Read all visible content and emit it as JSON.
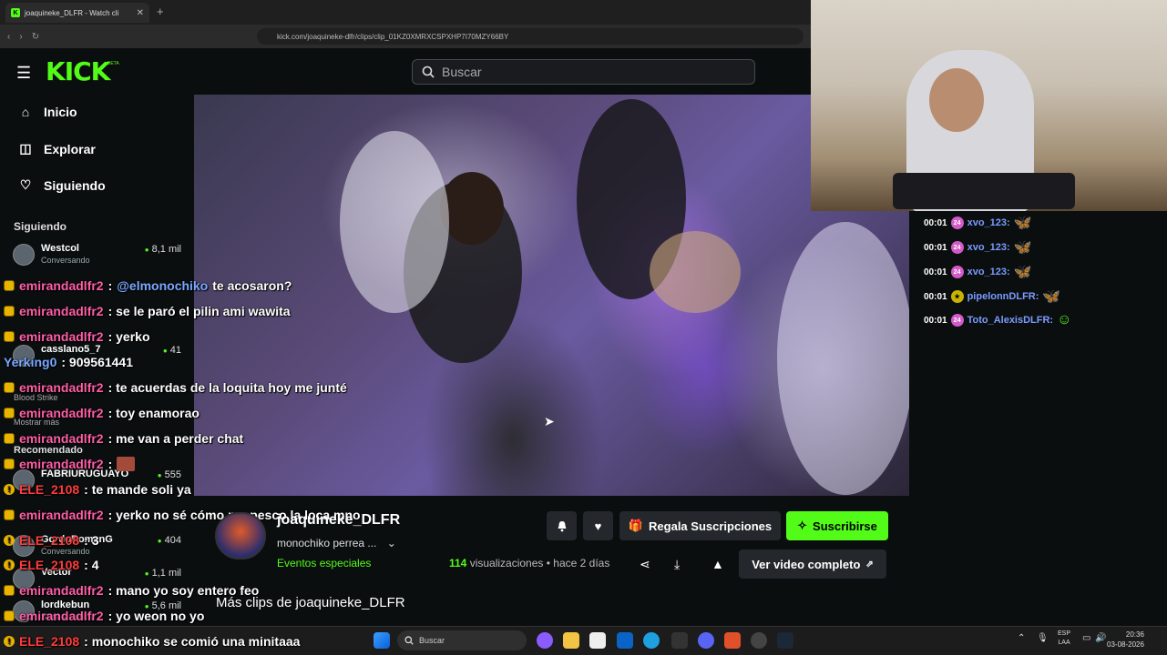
{
  "browser": {
    "tab_title": "joaquineke_DLFR - Watch cli",
    "url": "kick.com/joaquineke-dlfr/clips/clip_01KZ0XMRXCSPXHP7I70MZY66BY",
    "new_tab": "+",
    "close": "✕"
  },
  "header": {
    "logo": "KICK",
    "logo_beta": "BETA",
    "search_placeholder": "Buscar"
  },
  "sidebar": {
    "nav": [
      {
        "label": "Inicio",
        "icon": "home-icon"
      },
      {
        "label": "Explorar",
        "icon": "compass-icon"
      },
      {
        "label": "Siguiendo",
        "icon": "heart-icon"
      }
    ],
    "following_heading": "Siguiendo",
    "channels": [
      {
        "name": "Westcol",
        "category": "Conversando",
        "viewers": "8,1 mil"
      },
      {
        "name": "casslano5_7",
        "category": "",
        "viewers": "41"
      },
      {
        "name": "FABRIURUGUAYO",
        "category": "",
        "viewers": "555"
      },
      {
        "name": "GordoRomanG",
        "category": "Conversando",
        "viewers": "404"
      },
      {
        "name": "Vector",
        "category": "",
        "viewers": "1,1 mil"
      },
      {
        "name": "lordkebun",
        "category": "Slots & Casino",
        "viewers": "5,6 mil"
      }
    ],
    "show_more": "Mostrar más",
    "recommended_heading": "Recomendado",
    "blood_strike": "Blood Strike"
  },
  "overlay_chat": [
    {
      "user": "emirandadlfr2",
      "text": ": ",
      "mention": "@elmonochiko",
      "rest": " te acosaron?"
    },
    {
      "user": "emirandadlfr2",
      "text": ": se le paró el pilin ami wawita"
    },
    {
      "user": "emirandadlfr2",
      "text": ": yerko"
    },
    {
      "user": "Yerking0",
      "text": ": 909561441"
    },
    {
      "user": "emirandadlfr2",
      "text": ": te acuerdas de la loquita hoy me junté"
    },
    {
      "user": "emirandadlfr2",
      "text": ": toy enamorao"
    },
    {
      "user": "emirandadlfr2",
      "text": ": me van a perder chat"
    },
    {
      "user": "emirandadlfr2",
      "text": ":"
    },
    {
      "user": "ELE_2108",
      "text": ": te mande soli ya"
    },
    {
      "user": "emirandadlfr2",
      "text": ": yerko no sé cómo me pesco la loca mno"
    },
    {
      "user": "ELE_2108",
      "text": ": 3"
    },
    {
      "user": "ELE_2108",
      "text": ": 4"
    },
    {
      "user": "emirandadlfr2",
      "text": ": mano yo soy entero feo"
    },
    {
      "user": "emirandadlfr2",
      "text": ": yo weon no yo"
    },
    {
      "user": "ELE_2108",
      "text": ": monochiko se comió una minitaaa"
    }
  ],
  "right_chat": [
    {
      "time": "00:01",
      "badge": "24",
      "user": "xvo_123:",
      "emote": "🦋"
    },
    {
      "time": "00:01",
      "badge": "24",
      "user": "xvo_123:",
      "emote": "🦋"
    },
    {
      "time": "00:01",
      "badge": "24",
      "user": "xvo_123:",
      "emote": "🦋"
    },
    {
      "time": "00:01",
      "badge": "★",
      "user": "pipelonnDLFR:",
      "emote": "🦋"
    },
    {
      "time": "00:01",
      "badge": "24",
      "user": "Toto_AlexisDLFR:",
      "emote": "☺"
    }
  ],
  "clip": {
    "channel": "joaquineke_DLFR",
    "title": "monochiko  perrea ...",
    "category": "Eventos especiales",
    "views": "114",
    "views_label": " visualizaciones",
    "age": "hace 2 días",
    "gift": "Regala Suscripciones",
    "subscribe": "Suscribirse",
    "full_video": "Ver video completo",
    "more_clips": "Más clips de joaquineke_DLFR"
  },
  "taskbar": {
    "search": "Buscar",
    "lang_line1": "ESP",
    "lang_line2": "LAA",
    "time": "20:36",
    "date": "03-08-2026"
  },
  "colors": {
    "kick_green": "#53fc18",
    "background": "#0b0e0f"
  }
}
